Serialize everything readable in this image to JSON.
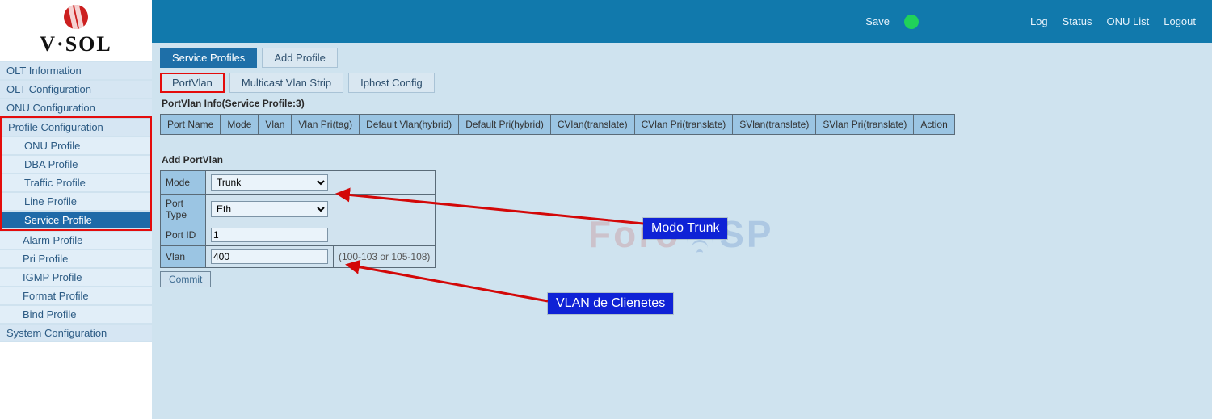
{
  "logo_text": "V·SOL",
  "topbar": {
    "save": "Save",
    "log": "Log",
    "status": "Status",
    "onu_list": "ONU List",
    "logout": "Logout"
  },
  "sidebar": {
    "groups": [
      {
        "label": "OLT Information"
      },
      {
        "label": "OLT Configuration"
      },
      {
        "label": "ONU Configuration"
      },
      {
        "label": "Profile Configuration",
        "highlighted": true,
        "items": [
          {
            "label": "ONU Profile"
          },
          {
            "label": "DBA Profile"
          },
          {
            "label": "Traffic Profile"
          },
          {
            "label": "Line Profile"
          },
          {
            "label": "Service Profile",
            "active": true
          },
          {
            "label": "Alarm Profile"
          },
          {
            "label": "Pri Profile"
          },
          {
            "label": "IGMP Profile"
          },
          {
            "label": "Format Profile"
          },
          {
            "label": "Bind Profile"
          }
        ]
      },
      {
        "label": "System Configuration"
      }
    ]
  },
  "tabs_primary": [
    {
      "label": "Service Profiles",
      "active": true
    },
    {
      "label": "Add Profile"
    }
  ],
  "tabs_secondary": [
    {
      "label": "PortVlan",
      "active": true
    },
    {
      "label": "Multicast Vlan Strip"
    },
    {
      "label": "Iphost Config"
    }
  ],
  "headings": {
    "info": "PortVlan Info(Service Profile:3)",
    "add": "Add PortVlan"
  },
  "info_columns": [
    "Port Name",
    "Mode",
    "Vlan",
    "Vlan Pri(tag)",
    "Default Vlan(hybrid)",
    "Default Pri(hybrid)",
    "CVlan(translate)",
    "CVlan Pri(translate)",
    "SVlan(translate)",
    "SVlan Pri(translate)",
    "Action"
  ],
  "form": {
    "mode_label": "Mode",
    "mode_value": "Trunk",
    "port_type_label": "Port Type",
    "port_type_value": "Eth",
    "port_id_label": "Port ID",
    "port_id_value": "1",
    "vlan_label": "Vlan",
    "vlan_value": "400",
    "vlan_hint": "(100-103 or 105-108)",
    "commit_label": "Commit"
  },
  "annotations": {
    "mode_trunk": "Modo Trunk",
    "vlan_clientes": "VLAN de Clienetes"
  },
  "watermark_text_left": "Foro",
  "watermark_text_right": "SP"
}
